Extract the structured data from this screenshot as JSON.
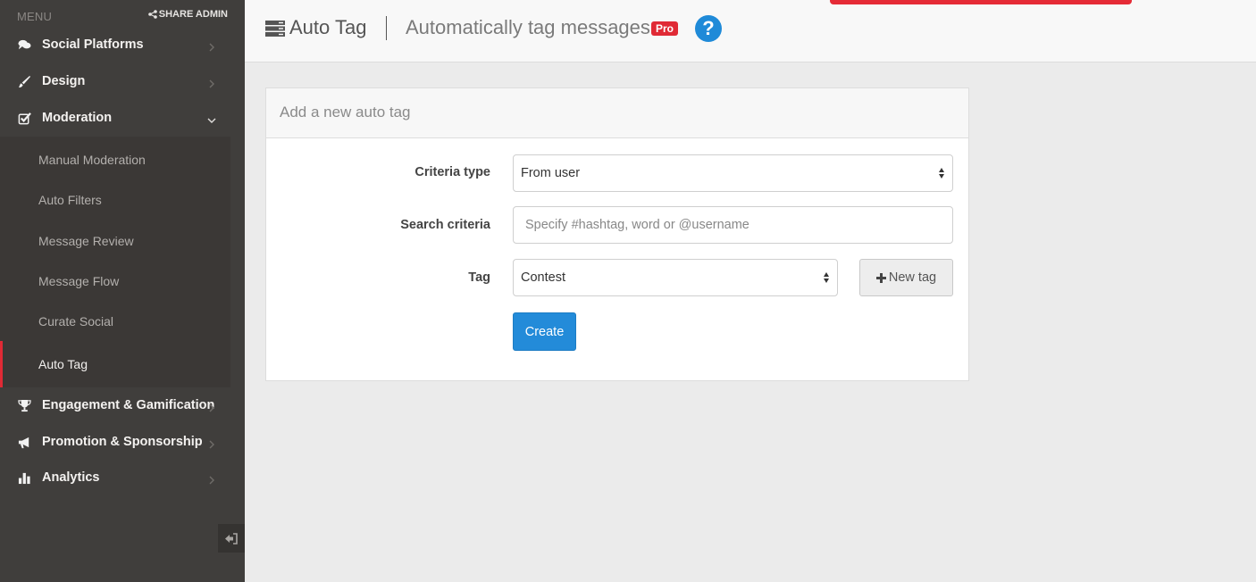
{
  "sidebar": {
    "menu_label": "MENU",
    "share_admin_label": "SHARE ADMIN",
    "items": [
      {
        "label": "Social Platforms",
        "icon": "comments-icon"
      },
      {
        "label": "Design",
        "icon": "brush-icon"
      },
      {
        "label": "Moderation",
        "icon": "check-square-icon",
        "expanded": true
      },
      {
        "label": "Engagement & Gamification",
        "icon": "trophy-icon"
      },
      {
        "label": "Promotion & Sponsorship",
        "icon": "bullhorn-icon"
      },
      {
        "label": "Analytics",
        "icon": "bar-chart-icon"
      }
    ],
    "moderation_subitems": [
      {
        "label": "Manual Moderation"
      },
      {
        "label": "Auto Filters"
      },
      {
        "label": "Message Review"
      },
      {
        "label": "Message Flow"
      },
      {
        "label": "Curate Social"
      },
      {
        "label": "Auto Tag",
        "active": true
      }
    ]
  },
  "header": {
    "title": "Auto Tag",
    "subtitle": "Automatically tag messages",
    "badge": "Pro",
    "help": "?"
  },
  "panel": {
    "title": "Add a new auto tag",
    "criteria_type": {
      "label": "Criteria type",
      "value": "From user"
    },
    "search_criteria": {
      "label": "Search criteria",
      "value": "",
      "placeholder": "Specify #hashtag, word or @username"
    },
    "tag": {
      "label": "Tag",
      "value": "Contest"
    },
    "new_tag_label": "New tag",
    "create_label": "Create"
  },
  "colors": {
    "accent": "#e02a35",
    "primary": "#238bd9",
    "sidebar_bg": "#403e3c"
  }
}
